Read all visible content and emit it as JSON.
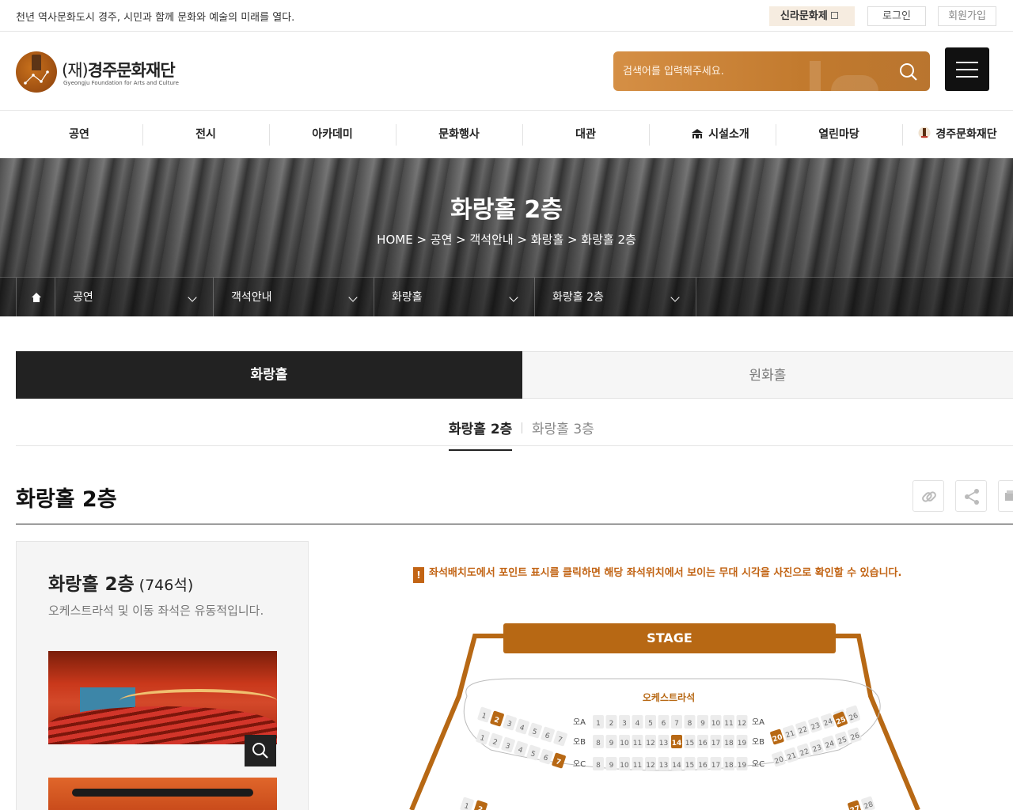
{
  "topbar": {
    "slogan": "천년 역사문화도시 경주, 시민과 함께 문화와 예술의 미래를 열다.",
    "silla_link": "신라문화제",
    "login": "로그인",
    "join": "회원가입"
  },
  "header": {
    "logo_prefix": "(재)",
    "logo_name": "경주문화재단",
    "logo_sub": "Gyeongju Foundation for Arts and Culture",
    "search_placeholder": "검색어를 입력해주세요."
  },
  "gnb": [
    {
      "label": "공연"
    },
    {
      "label": "전시"
    },
    {
      "label": "아카데미"
    },
    {
      "label": "문화행사"
    },
    {
      "label": "대관"
    },
    {
      "label": "시설소개",
      "icon": "building-icon"
    },
    {
      "label": "열린마당"
    },
    {
      "label": "경주문화재단",
      "icon": "tower-icon"
    }
  ],
  "visual": {
    "title": "화랑홀 2층",
    "breadcrumb": "HOME > 공연 > 객석안내 > 화랑홀 > 화랑홀 2층"
  },
  "subnav": [
    "공연",
    "객석안내",
    "화랑홀",
    "화랑홀 2층"
  ],
  "tabs": {
    "active": "화랑홀",
    "inactive": "원화홀"
  },
  "subtabs": {
    "active": "화랑홀 2층",
    "inactive": "화랑홀 3층"
  },
  "page_title": "화랑홀 2층",
  "left_panel": {
    "title": "화랑홀 2층",
    "count": "(746석)",
    "desc": "오케스트라석 및 이동 좌석은 유동적입니다."
  },
  "seating": {
    "notice": "좌석배치도에서 포인트 표시를 클릭하면 해당 좌석위치에서 보이는 무대 시각을 사진으로 확인할 수 있습니다.",
    "notice_icon": "!",
    "stage": "STAGE",
    "orchestra": "오케스트라석",
    "row_labels": {
      "a": "오A",
      "b": "오B",
      "c": "오C"
    },
    "left_rows": [
      [
        "1",
        "2",
        "3",
        "4",
        "5",
        "6",
        "7"
      ],
      [
        "1",
        "2",
        "3",
        "4",
        "5",
        "6",
        "7"
      ]
    ],
    "center_rows": [
      [
        "1",
        "2",
        "3",
        "4",
        "5",
        "6",
        "7",
        "8",
        "9",
        "10",
        "11",
        "12"
      ],
      [
        "8",
        "9",
        "10",
        "11",
        "12",
        "13",
        "14",
        "15",
        "16",
        "17",
        "18",
        "19"
      ],
      [
        "8",
        "9",
        "10",
        "11",
        "12",
        "13",
        "14",
        "15",
        "16",
        "17",
        "18",
        "19"
      ]
    ],
    "right_rows": [
      [
        "20",
        "21",
        "22",
        "23",
        "24",
        "25",
        "26"
      ],
      [
        "20",
        "21",
        "22",
        "23",
        "24",
        "25",
        "26"
      ]
    ],
    "right_top_extra": [
      "25",
      "26"
    ],
    "bottom_left": [
      "1",
      "2"
    ],
    "bottom_right": [
      "27",
      "28"
    ],
    "highlighted": {
      "left_row1": "2",
      "left_row2": "7",
      "center_row2": "14",
      "right_row1": "20",
      "right_extra": "25"
    },
    "accent_color": "#b76814"
  }
}
